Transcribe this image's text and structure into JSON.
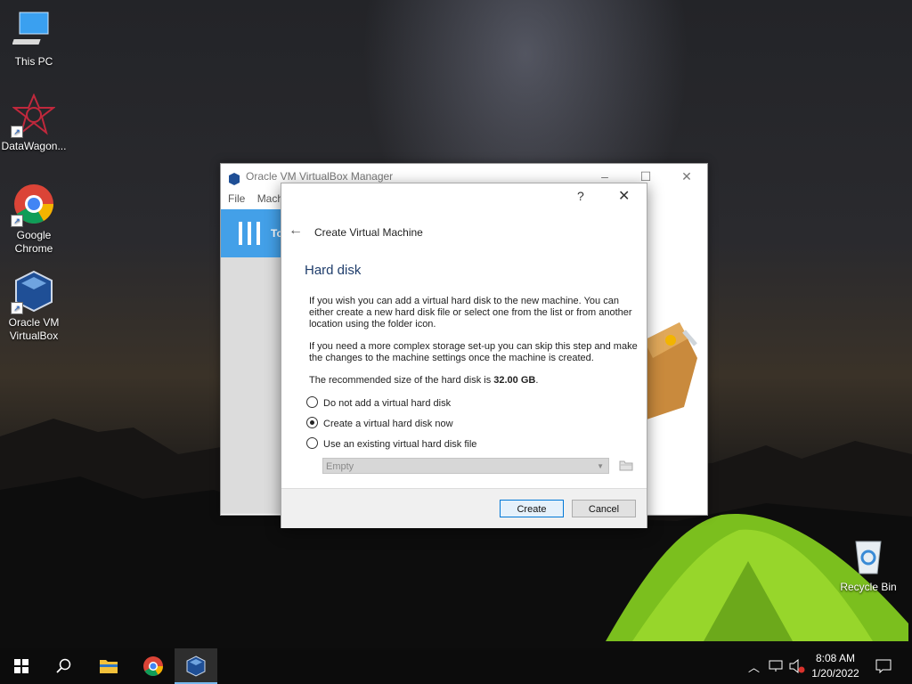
{
  "desktop": {
    "icons": [
      {
        "label": "This PC"
      },
      {
        "label": "DataWagon..."
      },
      {
        "label": "Google Chrome"
      },
      {
        "label": "Oracle VM VirtualBox"
      },
      {
        "label": "Recycle Bin"
      }
    ]
  },
  "manager_window": {
    "title": "Oracle VM VirtualBox Manager",
    "menu": [
      "File",
      "Mach"
    ],
    "tools_label": "To"
  },
  "dialog": {
    "help_glyph": "?",
    "close_glyph": "✕",
    "back_glyph": "←",
    "wizard_title": "Create Virtual Machine",
    "page_title": "Hard disk",
    "para1": "If you wish you can add a virtual hard disk to the new machine. You can either create a new hard disk file or select one from the list or from another location using the folder icon.",
    "para2": "If you need a more complex storage set-up you can skip this step and make the changes to the machine settings once the machine is created.",
    "recommend_prefix": "The recommended size of the hard disk is ",
    "recommend_size": "32.00 GB",
    "recommend_suffix": ".",
    "options": [
      {
        "label": "Do not add a virtual hard disk",
        "selected": false
      },
      {
        "label": "Create a virtual hard disk now",
        "selected": true
      },
      {
        "label": "Use an existing virtual hard disk file",
        "selected": false
      }
    ],
    "combo_value": "Empty",
    "create_label": "Create",
    "cancel_label": "Cancel"
  },
  "taskbar": {
    "time": "8:08 AM",
    "date": "1/20/2022",
    "accent": "#76b9ed"
  }
}
